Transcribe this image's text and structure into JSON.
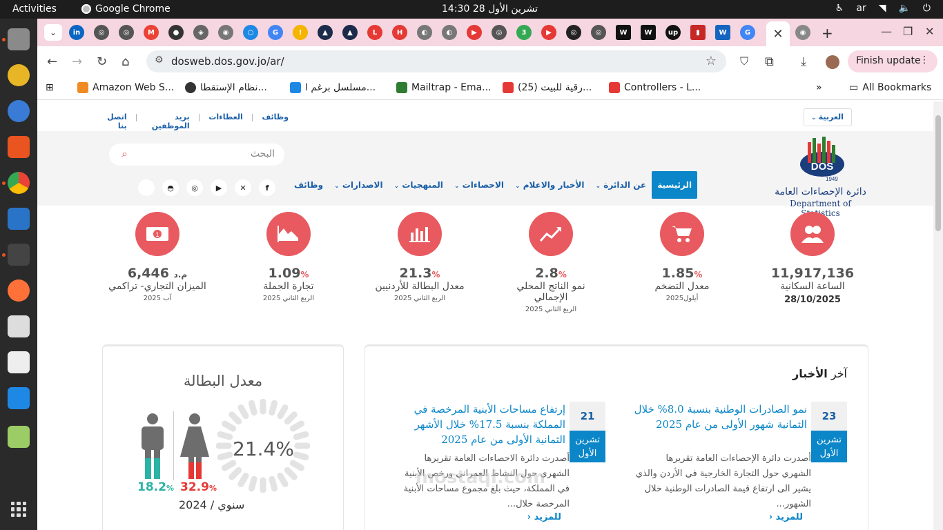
{
  "system": {
    "activities": "Activities",
    "app_name": "Google Chrome",
    "clock": "تشرين الأول 28  14:30",
    "lang": "ar"
  },
  "browser": {
    "url": "dosweb.dos.gov.jo/ar/",
    "finish_update": "Finish update",
    "bookmarks": [
      {
        "label": "Amazon Web S...",
        "color": "#f08a24"
      },
      {
        "label": "نظام الإستقطا...",
        "color": "#333333"
      },
      {
        "label": "مسلسل برغم ا...",
        "color": "#1e88e5"
      },
      {
        "label": "Mailtrap - Ema...",
        "color": "#2e7d32"
      },
      {
        "label": "(25) رقية للبيت...",
        "color": "#e53935"
      },
      {
        "label": "Controllers - L...",
        "color": "#e53935"
      }
    ],
    "all_bookmarks": "All Bookmarks"
  },
  "site": {
    "util_links": [
      "وظائف",
      "العطاءات",
      "بريد الموظفين",
      "اتصل بنا"
    ],
    "language": "العربية",
    "search_placeholder": "البحث",
    "nav": [
      {
        "label": "الرئيسية",
        "active": true
      },
      {
        "label": "عن الدائرة"
      },
      {
        "label": "الأخبار والاعلام"
      },
      {
        "label": "الاحصاءات"
      },
      {
        "label": "المنهجيات"
      },
      {
        "label": "الاصدارات"
      },
      {
        "label": "وظائف"
      }
    ],
    "logo_ar": "دائرة الإحصاءات العامة",
    "logo_en": "Department of Statistics",
    "logo_text": "DOS",
    "logo_year": "1949"
  },
  "stats": [
    {
      "value": "11,917,136",
      "unit": "",
      "label": "الساعة السكانية",
      "sub": "28/10/2025",
      "icon": "people-icon"
    },
    {
      "value": "1.85",
      "unit": "%",
      "label": "معدل التضخم",
      "sub": "أيلول2025",
      "icon": "cart-icon"
    },
    {
      "value": "2.8",
      "unit": "%",
      "label": "نمو الناتج المحلي الإجمالي",
      "sub": "الربع الثاني 2025",
      "icon": "trend-icon"
    },
    {
      "value": "21.3",
      "unit": "%",
      "label": "معدل البطالة للأردنيين",
      "sub": "الربع الثاني 2025",
      "icon": "bars-icon"
    },
    {
      "value": "1.09",
      "unit": "%",
      "label": "تجارة الجملة",
      "sub": "الربع الثاني 2025",
      "icon": "area-icon"
    },
    {
      "value": "6,446",
      "unit": "م.د",
      "label": "الميزان التجاري- تراكمي",
      "sub": "آب 2025",
      "icon": "money-icon"
    }
  ],
  "unemployment": {
    "title": "معدل البطالة",
    "total": "21.4%",
    "male": "18.2",
    "female": "32.9",
    "pct_sign": "%",
    "period": "سنوي / 2024",
    "male_color": "#2bb3a3",
    "female_color": "#e53935"
  },
  "news": {
    "heading_prefix": "آخر",
    "heading_bold": "الأخبار",
    "items": [
      {
        "day": "23",
        "month": "تشرين الأول",
        "title": "نمو الصادرات الوطنية بنسبة 8.0% خلال الثمانية شهور الأولى من عام 2025",
        "body": "أصدرت دائرة الإحصاءات العامة تقريرها الشهري حول التجارة الخارجية في الأردن والذي يشير الى ارتفاع قيمة الصادرات الوطنية خلال الشهور...",
        "more": "للمزيد"
      },
      {
        "day": "21",
        "month": "تشرين الأول",
        "title": "إرتفاع مساحات الأبنية المرخصة في المملكة بنسبة 17.5% خلال الأشهر الثمانية الأولى من عام 2025",
        "body": "أصدرت دائرة الاحصاءات العامة تقريرها الشهري حول النشاط العمراني ورخص الأبنية في المملكة، حيث بلغ مجموع مساحات الأبنية المرخصة خلال...",
        "more": "للمزيد"
      }
    ]
  },
  "watermark": "mostaql.com",
  "colors": {
    "accent": "#0b86c8",
    "stat_circle": "#e85a5f",
    "tab_bar": "#f6d6e0"
  }
}
